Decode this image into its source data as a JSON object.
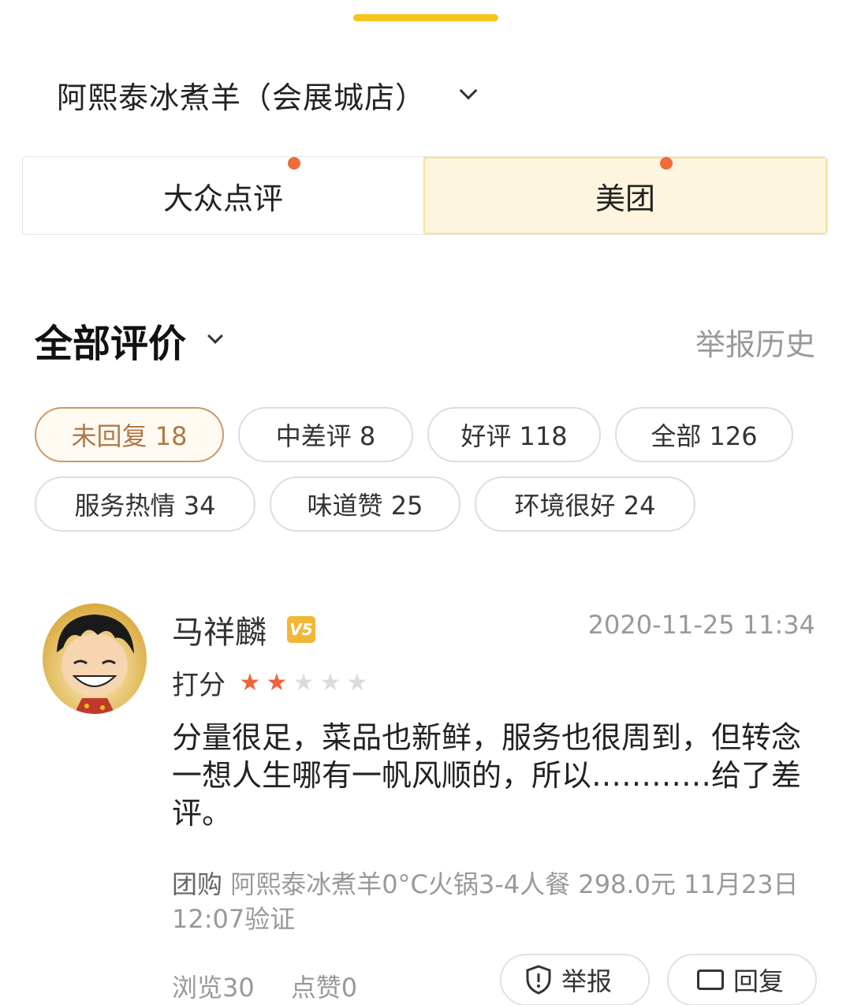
{
  "store": {
    "name": "阿熙泰冰煮羊（会展城店）"
  },
  "platform_tabs": [
    {
      "label": "大众点评",
      "active": false,
      "has_dot": true
    },
    {
      "label": "美团",
      "active": true,
      "has_dot": true
    }
  ],
  "section": {
    "title": "全部评价",
    "report_history": "举报历史"
  },
  "filters": {
    "row1": [
      {
        "label": "未回复 18",
        "active": true
      },
      {
        "label": "中差评 8",
        "active": false
      },
      {
        "label": "好评 118",
        "active": false
      },
      {
        "label": "全部 126",
        "active": false
      }
    ],
    "row2": [
      {
        "label": "服务热情 34",
        "active": false
      },
      {
        "label": "味道赞 25",
        "active": false
      },
      {
        "label": "环境很好 24",
        "active": false
      }
    ]
  },
  "review": {
    "username": "马祥麟",
    "badge": "V5",
    "time": "2020-11-25 11:34",
    "rating_label": "打分",
    "rating": 2,
    "rating_max": 5,
    "text": "分量很足，菜品也新鲜，服务也很周到，但转念一想人生哪有一帆风顺的，所以…………给了差评。",
    "deal_tag": "团购",
    "deal_text": "阿熙泰冰煮羊0°C火锅3-4人餐 298.0元  11月23日 12:07验证",
    "views": "浏览30",
    "likes": "点赞0",
    "report_label": "举报",
    "reply_label": "回复"
  },
  "colors": {
    "accent_yellow": "#f5c518",
    "active_tab_bg": "#fdf5dd",
    "red_dot": "#f26b3a",
    "star_on": "#f0623a",
    "chip_active": "#b07a44",
    "muted_text": "#999999"
  },
  "icons": {
    "store_dropdown": "chevron-down-icon",
    "filter_dropdown": "chevron-down-icon",
    "badge": "vip-badge-icon",
    "report": "shield-icon",
    "reply": "reply-icon"
  }
}
